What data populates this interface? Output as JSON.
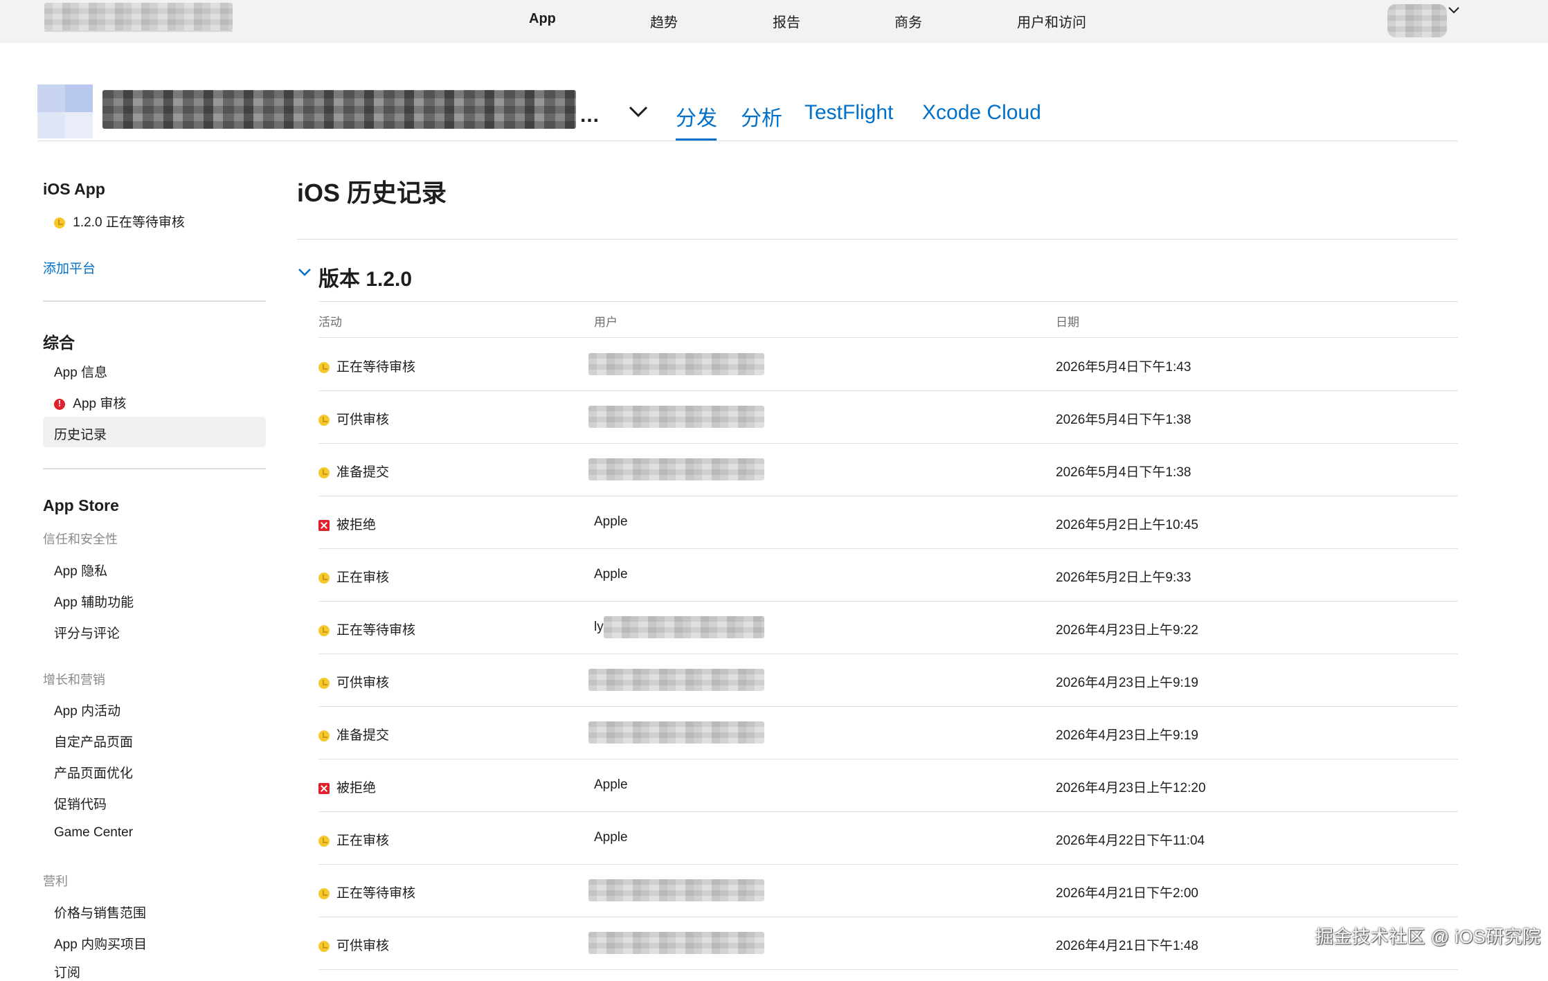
{
  "topnav": {
    "items": [
      "App",
      "趋势",
      "报告",
      "商务",
      "用户和访问"
    ]
  },
  "header": {
    "ellipsis": "...",
    "tabs": [
      "分发",
      "分析",
      "TestFlight",
      "Xcode Cloud"
    ],
    "active_tab": "分发"
  },
  "sidebar": {
    "ios_app": {
      "title": "iOS App",
      "version_status": "1.2.0 正在等待审核",
      "add_platform": "添加平台"
    },
    "general": {
      "title": "综合",
      "items": [
        "App 信息",
        "App 审核",
        "历史记录"
      ],
      "active": "历史记录"
    },
    "app_store": {
      "title": "App Store",
      "trust_section": "信任和安全性",
      "trust_items": [
        "App 隐私",
        "App 辅助功能",
        "评分与评论"
      ],
      "growth_section": "增长和营销",
      "growth_items": [
        "App 内活动",
        "自定产品页面",
        "产品页面优化",
        "促销代码",
        "Game Center"
      ],
      "monetize_section": "营利",
      "monetize_items": [
        "价格与销售范围",
        "App 内购买项目",
        "订阅"
      ]
    }
  },
  "main": {
    "title": "iOS 历史记录",
    "version_title": "版本 1.2.0",
    "columns": [
      "活动",
      "用户",
      "日期"
    ],
    "rows": [
      {
        "status": "yellow",
        "activity": "正在等待审核",
        "user": "",
        "date": "2026年5月4日下午1:43"
      },
      {
        "status": "yellow",
        "activity": "可供审核",
        "user": "",
        "date": "2026年5月4日下午1:38"
      },
      {
        "status": "yellow",
        "activity": "准备提交",
        "user": "",
        "date": "2026年5月4日下午1:38"
      },
      {
        "status": "red",
        "activity": "被拒绝",
        "user": "Apple",
        "date": "2026年5月2日上午10:45"
      },
      {
        "status": "yellow",
        "activity": "正在审核",
        "user": "Apple",
        "date": "2026年5月2日上午9:33"
      },
      {
        "status": "yellow",
        "activity": "正在等待审核",
        "user": "ly",
        "date": "2026年4月23日上午9:22"
      },
      {
        "status": "yellow",
        "activity": "可供审核",
        "user": "",
        "date": "2026年4月23日上午9:19"
      },
      {
        "status": "yellow",
        "activity": "准备提交",
        "user": "",
        "date": "2026年4月23日上午9:19"
      },
      {
        "status": "red",
        "activity": "被拒绝",
        "user": "Apple",
        "date": "2026年4月23日上午12:20"
      },
      {
        "status": "yellow",
        "activity": "正在审核",
        "user": "Apple",
        "date": "2026年4月22日下午11:04"
      },
      {
        "status": "yellow",
        "activity": "正在等待审核",
        "user": "",
        "date": "2026年4月21日下午2:00"
      },
      {
        "status": "yellow",
        "activity": "可供审核",
        "user": "",
        "date": "2026年4月21日下午1:48"
      }
    ]
  },
  "watermark": "掘金技术社区 @ iOS研究院",
  "colors": {
    "accent": "#0070c9",
    "status_yellow": "#f7c72b",
    "status_red": "#e0202a",
    "topbar_bg": "#f2f2f2"
  }
}
